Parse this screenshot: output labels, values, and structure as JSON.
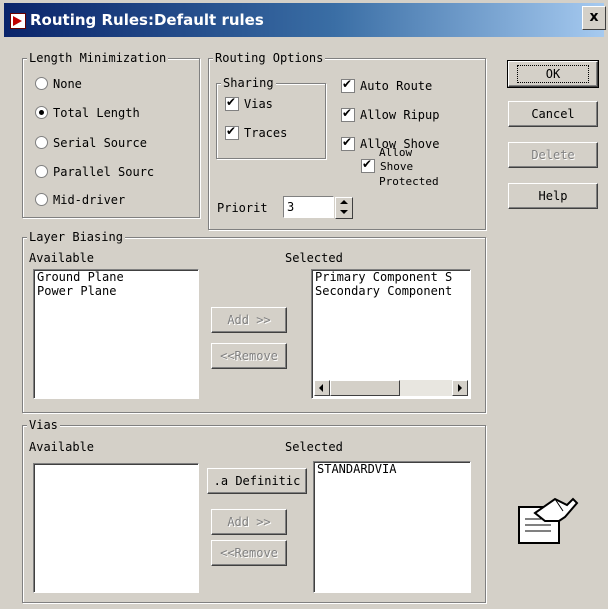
{
  "window": {
    "title": "Routing Rules:Default rules",
    "close_label": "x"
  },
  "length_min": {
    "legend": "Length Minimization",
    "options": [
      "None",
      "Total Length",
      "Serial Source",
      "Parallel Sourc",
      "Mid-driver"
    ],
    "selected": "Total Length"
  },
  "routing_options": {
    "legend": "Routing Options",
    "sharing_legend": "Sharing",
    "vias_label": "Vias",
    "vias_checked": true,
    "traces_label": "Traces",
    "traces_checked": true,
    "auto_route_label": "Auto Route",
    "auto_route_checked": true,
    "allow_ripup_label": "Allow Ripup",
    "allow_ripup_checked": true,
    "allow_shove_label": "Allow Shove",
    "allow_shove_checked": true,
    "allow_shove_protected_line1": "Allow",
    "allow_shove_protected_line2": "Shove",
    "allow_shove_protected_line3": "Protected",
    "allow_shove_protected_checked": true,
    "priority_label": "Priorit",
    "priority_value": "3"
  },
  "buttons": {
    "ok": "OK",
    "cancel": "Cancel",
    "delete": "Delete",
    "help": "Help"
  },
  "layer_biasing": {
    "legend": "Layer Biasing",
    "available_label": "Available",
    "selected_label": "Selected",
    "available": [
      "Ground Plane",
      "Power Plane"
    ],
    "selected": [
      "Primary Component S",
      "Secondary Component"
    ],
    "add_label": "Add >>",
    "remove_label": "<<Remove"
  },
  "vias": {
    "legend": "Vias",
    "available_label": "Available",
    "selected_label": "Selected",
    "available": [],
    "selected": [
      "STANDARDVIA"
    ],
    "definition_label": ".a Definitic",
    "add_label": "Add >>",
    "remove_label": "<<Remove"
  }
}
